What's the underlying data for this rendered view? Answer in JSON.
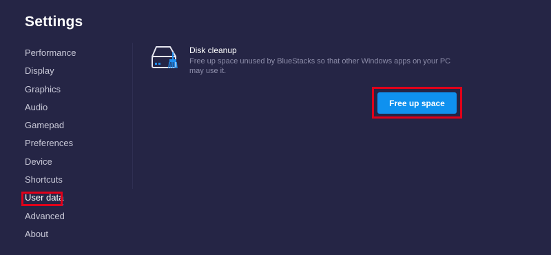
{
  "page": {
    "title": "Settings"
  },
  "sidebar": {
    "items": [
      {
        "label": "Performance",
        "name": "sidebar-item-performance",
        "active": false
      },
      {
        "label": "Display",
        "name": "sidebar-item-display",
        "active": false
      },
      {
        "label": "Graphics",
        "name": "sidebar-item-graphics",
        "active": false
      },
      {
        "label": "Audio",
        "name": "sidebar-item-audio",
        "active": false
      },
      {
        "label": "Gamepad",
        "name": "sidebar-item-gamepad",
        "active": false
      },
      {
        "label": "Preferences",
        "name": "sidebar-item-preferences",
        "active": false
      },
      {
        "label": "Device",
        "name": "sidebar-item-device",
        "active": false
      },
      {
        "label": "Shortcuts",
        "name": "sidebar-item-shortcuts",
        "active": false
      },
      {
        "label": "User data",
        "name": "sidebar-item-user-data",
        "active": true
      },
      {
        "label": "Advanced",
        "name": "sidebar-item-advanced",
        "active": false
      },
      {
        "label": "About",
        "name": "sidebar-item-about",
        "active": false
      }
    ]
  },
  "disk_cleanup": {
    "icon": "disk-cleanup-icon",
    "title": "Disk cleanup",
    "description": "Free up space unused by BlueStacks so that other Windows apps on your PC may use it.",
    "button_label": "Free up space"
  },
  "colors": {
    "background": "#252545",
    "accent": "#0f91ef",
    "highlight": "#e0001a",
    "muted_text": "#8e8eaa"
  }
}
